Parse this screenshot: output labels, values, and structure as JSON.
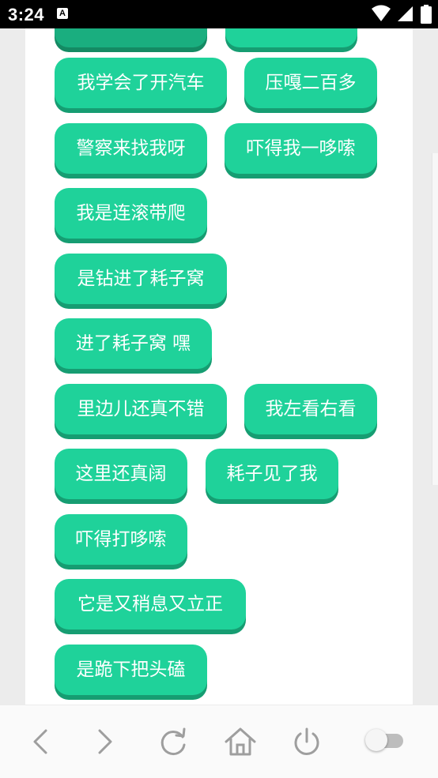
{
  "status_bar": {
    "time": "3:24",
    "notification_glyph": "A",
    "icons": [
      "wifi-icon",
      "signal-icon",
      "battery-icon"
    ]
  },
  "buttons": [
    {
      "label": ""
    },
    {
      "label": ""
    },
    {
      "label": "我学会了开汽车"
    },
    {
      "label": "压嘎二百多"
    },
    {
      "label": "警察来找我呀"
    },
    {
      "label": "吓得我一哆嗦"
    },
    {
      "label": "我是连滚带爬"
    },
    {
      "label": "是钻进了耗子窝"
    },
    {
      "label": "进了耗子窝 嘿"
    },
    {
      "label": "里边儿还真不错"
    },
    {
      "label": "我左看右看"
    },
    {
      "label": "这里还真阔"
    },
    {
      "label": "耗子见了我"
    },
    {
      "label": "吓得打哆嗦"
    },
    {
      "label": "它是又稍息又立正"
    },
    {
      "label": "是跪下把头磕"
    }
  ],
  "colors": {
    "pill": "#1fd29a",
    "pill_shadow": "#169d72",
    "pill_top_dark": "#1aae7f",
    "nav_icon": "#9e9e9e"
  },
  "nav_bar": {
    "icons": [
      "back-icon",
      "forward-icon",
      "reload-icon",
      "home-icon",
      "power-icon",
      "toggle-switch"
    ],
    "toggle_on": false
  }
}
